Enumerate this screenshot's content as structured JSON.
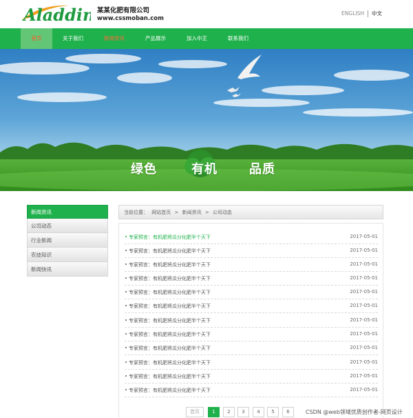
{
  "header": {
    "logo_text": "Aladdin",
    "company": "某某化肥有限公司",
    "site": "www.cssmoban.com",
    "lang_en": "ENGLISH",
    "lang_cn": "中文"
  },
  "nav": {
    "items": [
      {
        "label": "首页"
      },
      {
        "label": "关于我们"
      },
      {
        "label": "新闻资讯"
      },
      {
        "label": "产品展示"
      },
      {
        "label": "加入中正"
      },
      {
        "label": "联系我们"
      }
    ]
  },
  "banner": {
    "slogans": [
      "绿色",
      "有机",
      "品质"
    ]
  },
  "sidebar": {
    "title": "新闻资讯",
    "items": [
      {
        "label": "公司动态"
      },
      {
        "label": "行业新闻"
      },
      {
        "label": "农技知识"
      },
      {
        "label": "新闻快讯"
      }
    ]
  },
  "breadcrumb": {
    "prefix": "当前位置：",
    "home": "网站首页",
    "sep1": ">",
    "section": "新闻资讯",
    "sep2": ">",
    "current": "公司动态"
  },
  "news": {
    "rows": [
      {
        "title": "专家预言：有机肥将瓜分化肥半个天下",
        "date": "2017-05-01"
      },
      {
        "title": "专家预言：有机肥将瓜分化肥半个天下",
        "date": "2017-05-01"
      },
      {
        "title": "专家预言：有机肥将瓜分化肥半个天下",
        "date": "2017-05-01"
      },
      {
        "title": "专家预言：有机肥将瓜分化肥半个天下",
        "date": "2017-05-01"
      },
      {
        "title": "专家预言：有机肥将瓜分化肥半个天下",
        "date": "2017-05-01"
      },
      {
        "title": "专家预言：有机肥将瓜分化肥半个天下",
        "date": "2017-05-01"
      },
      {
        "title": "专家预言：有机肥将瓜分化肥半个天下",
        "date": "2017-05-01"
      },
      {
        "title": "专家预言：有机肥将瓜分化肥半个天下",
        "date": "2017-05-01"
      },
      {
        "title": "专家预言：有机肥将瓜分化肥半个天下",
        "date": "2017-05-01"
      },
      {
        "title": "专家预言：有机肥将瓜分化肥半个天下",
        "date": "2017-05-01"
      },
      {
        "title": "专家预言：有机肥将瓜分化肥半个天下",
        "date": "2017-05-01"
      },
      {
        "title": "专家预言：有机肥将瓜分化肥半个天下",
        "date": "2017-05-01"
      }
    ]
  },
  "pager": {
    "prev": "首页",
    "pages": [
      "1",
      "2",
      "3",
      "4",
      "5",
      "6"
    ],
    "current": "1"
  },
  "watermark": "CSDN @web领域优质创作者-网页设计",
  "colors": {
    "brand_green": "#1fb14c",
    "nav_active_text": "#ff5a2a"
  }
}
